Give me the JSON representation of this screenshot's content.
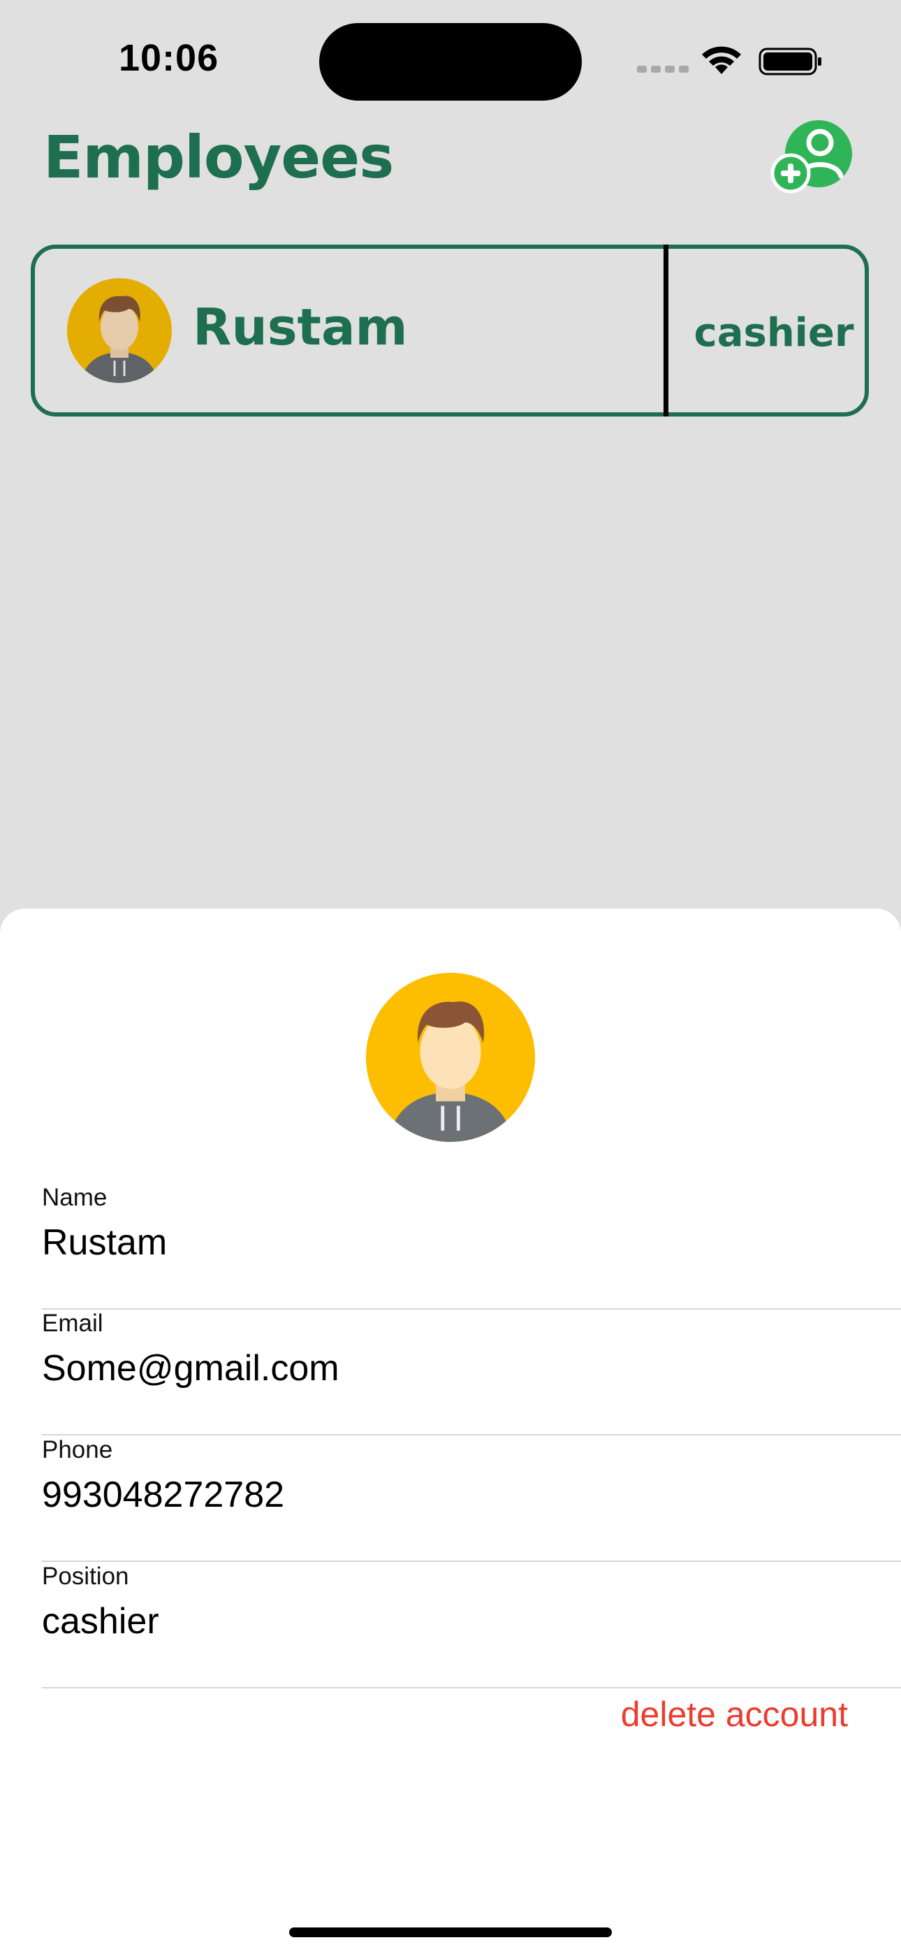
{
  "status_bar": {
    "time": "10:06"
  },
  "header": {
    "title": "Employees",
    "add_icon": "add-user-icon",
    "accent_color": "#1e6e52",
    "add_color": "#2fb457"
  },
  "employees": [
    {
      "name": "Rustam",
      "position": "cashier",
      "avatar_icon": "person-avatar-icon"
    }
  ],
  "sheet": {
    "fields": [
      {
        "label": "Name",
        "value": "Rustam"
      },
      {
        "label": "Email",
        "value": "Some@gmail.com"
      },
      {
        "label": "Phone",
        "value": "993048272782"
      },
      {
        "label": "Position",
        "value": "cashier"
      }
    ],
    "delete_label": "delete account",
    "delete_color": "#ee3b2f"
  }
}
